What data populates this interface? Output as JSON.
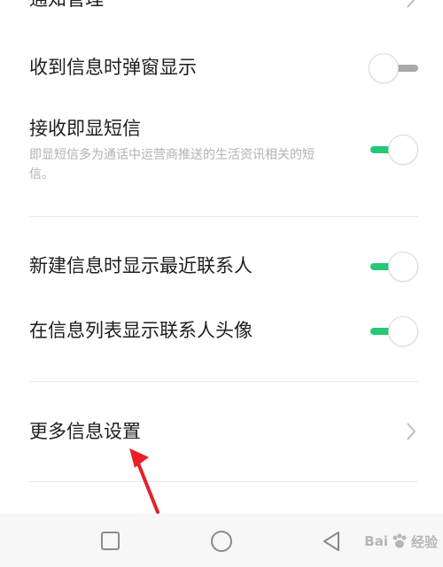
{
  "settings": {
    "notification_management": {
      "title": "通知管理"
    },
    "popup_on_receive": {
      "title": "收到信息时弹窗显示",
      "enabled": false
    },
    "flash_sms": {
      "title": "接收即显短信",
      "description": "即显短信多为通话中运营商推送的生活资讯相关的短信。",
      "enabled": true
    },
    "show_recent_contacts": {
      "title": "新建信息时显示最近联系人",
      "enabled": true
    },
    "show_contact_avatar": {
      "title": "在信息列表显示联系人头像",
      "enabled": true
    },
    "more_settings": {
      "title": "更多信息设置"
    }
  },
  "colors": {
    "toggle_on": "#24c876",
    "toggle_off": "#aaaaaa",
    "annotation_arrow": "#e8202a"
  },
  "watermark": {
    "brand_left": "Bai",
    "brand_right": "经验"
  }
}
